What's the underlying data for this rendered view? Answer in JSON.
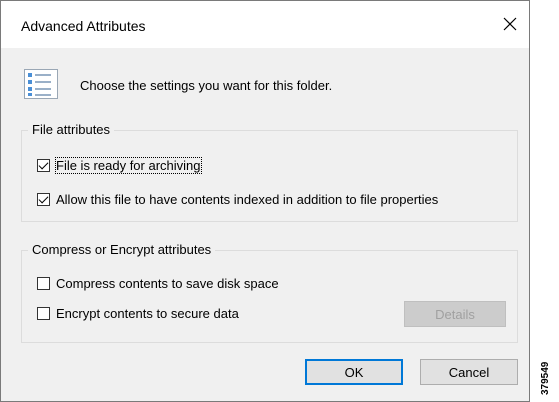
{
  "dialog": {
    "title": "Advanced Attributes",
    "close_icon": "close-icon",
    "header_icon": "attributes-list-icon",
    "header_text": "Choose the settings you want for this folder."
  },
  "file_attributes": {
    "label": "File attributes",
    "archive": {
      "label": "File is ready for archiving",
      "checked": true
    },
    "indexed": {
      "label": "Allow this file to have contents indexed in addition to file properties",
      "checked": true
    }
  },
  "compress_encrypt": {
    "label": "Compress or Encrypt attributes",
    "compress": {
      "label": "Compress contents to save disk space",
      "checked": false
    },
    "encrypt": {
      "label": "Encrypt contents to secure data",
      "checked": false
    },
    "details_label": "Details"
  },
  "buttons": {
    "ok": "OK",
    "cancel": "Cancel"
  },
  "figure_id": "379549",
  "colors": {
    "accent": "#0078d7",
    "dialog_bg": "#f0f0f0"
  }
}
